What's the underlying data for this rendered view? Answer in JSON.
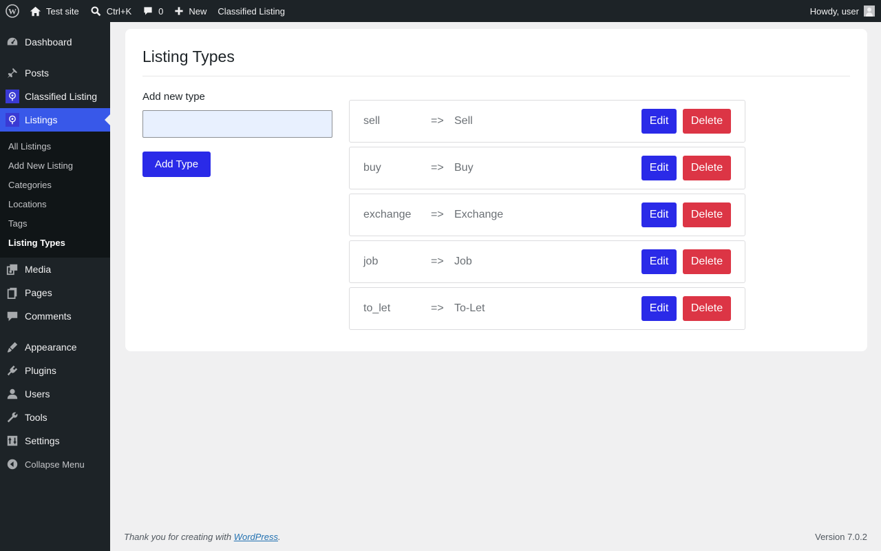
{
  "adminbar": {
    "site_name": "Test site",
    "search_shortcut": "Ctrl+K",
    "comments_count": "0",
    "new_label": "New",
    "plugin_link": "Classified Listing",
    "howdy": "Howdy, user"
  },
  "sidebar": {
    "items": [
      {
        "label": "Dashboard",
        "icon": "dashboard-icon"
      },
      {
        "label": "Posts",
        "icon": "pin-icon"
      },
      {
        "label": "Classified Listing",
        "icon": "classified-listing-icon"
      },
      {
        "label": "Listings",
        "icon": "classified-listing-icon"
      },
      {
        "label": "Media",
        "icon": "media-icon"
      },
      {
        "label": "Pages",
        "icon": "pages-icon"
      },
      {
        "label": "Comments",
        "icon": "comment-icon"
      },
      {
        "label": "Appearance",
        "icon": "brush-icon"
      },
      {
        "label": "Plugins",
        "icon": "plugin-icon"
      },
      {
        "label": "Users",
        "icon": "user-icon"
      },
      {
        "label": "Tools",
        "icon": "wrench-icon"
      },
      {
        "label": "Settings",
        "icon": "settings-icon"
      }
    ],
    "submenu": [
      "All Listings",
      "Add New Listing",
      "Categories",
      "Locations",
      "Tags",
      "Listing Types"
    ],
    "collapse_label": "Collapse Menu"
  },
  "main": {
    "title": "Listing Types",
    "add_label": "Add new type",
    "input_value": "",
    "add_button": "Add Type",
    "types": [
      {
        "key": "sell",
        "arrow": "=>",
        "value": "Sell",
        "edit": "Edit",
        "delete": "Delete"
      },
      {
        "key": "buy",
        "arrow": "=>",
        "value": "Buy",
        "edit": "Edit",
        "delete": "Delete"
      },
      {
        "key": "exchange",
        "arrow": "=>",
        "value": "Exchange",
        "edit": "Edit",
        "delete": "Delete"
      },
      {
        "key": "job",
        "arrow": "=>",
        "value": "Job",
        "edit": "Edit",
        "delete": "Delete"
      },
      {
        "key": "to_let",
        "arrow": "=>",
        "value": "To-Let",
        "edit": "Edit",
        "delete": "Delete"
      }
    ]
  },
  "footer": {
    "thanks_prefix": "Thank you for creating with ",
    "thanks_link": "WordPress",
    "thanks_suffix": ".",
    "version": "Version 7.0.2"
  },
  "colors": {
    "sidebar_bg": "#1d2327",
    "sidebar_active": "#3858e9",
    "primary_button": "#2a2ae8",
    "danger_button": "#dc3545",
    "page_bg": "#f0f0f1"
  }
}
